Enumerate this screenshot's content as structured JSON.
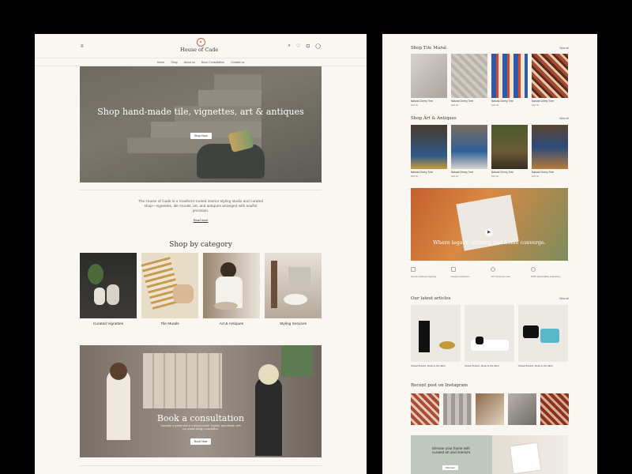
{
  "left": {
    "menu_icon": "menu-icon",
    "brand": "House of Cade",
    "header_icons": [
      "search-icon",
      "heart-icon",
      "bag-icon",
      "user-icon"
    ],
    "nav": [
      "Home",
      "Shop",
      "About us",
      "Book Consultation",
      "Contact us"
    ],
    "hero": {
      "title": "Shop hand-made tile, vignettes, art & antiques",
      "button": "Shop Now"
    },
    "intro": {
      "text": "The House of Cade is a Southern-rooted interior styling studio and curated shop—vignettes, tile murals, art, and antiques arranged with soulful precision.",
      "link": "Read more"
    },
    "category_title": "Shop by category",
    "categories": [
      "Curated Vignettes",
      "Tile Murals",
      "Art & Antiques",
      "Styling Services"
    ],
    "consult": {
      "title": "Book a consultation",
      "text": "Schedule a private visit or a virtual consult. Explore, and elevate, with our private design consultation.",
      "button": "Book Now"
    }
  },
  "right": {
    "tile_title": "Shop Tile Mural",
    "view_all": "View all",
    "tiles": [
      {
        "name": "Natural Cherry Tree",
        "price": "$48.00"
      },
      {
        "name": "Natural Cherry Tree",
        "price": "$48.00"
      },
      {
        "name": "Natural Cherry Tree",
        "price": "$48.00"
      },
      {
        "name": "Natural Cherry Tree",
        "price": "$48.00"
      }
    ],
    "art_title": "Shop Art & Antiques",
    "arts": [
      {
        "name": "Natural Cherry Tree",
        "price": "$48.00"
      },
      {
        "name": "Natural Cherry Tree",
        "price": "$48.00"
      },
      {
        "name": "Natural Cherry Tree",
        "price": "$48.00"
      },
      {
        "name": "Natural Cherry Tree",
        "price": "$48.00"
      }
    ],
    "video_caption": "Where legacy, artistry, and home converge.",
    "features": [
      "Secure checkout shipping",
      "Curated collections",
      "24/7 Customer care",
      "100% Handcrafted Guarantee"
    ],
    "articles_title": "Our latest articles",
    "articles": [
      "Vessel flowers: ideas to the label",
      "Vessel flowers: ideas to the label",
      "Vessel flowers: ideas to the label"
    ],
    "instagram_title": "Recent post on Instagram",
    "promo": {
      "text": "Elevate your home with curated art and interiors",
      "button": "Discover"
    },
    "colors": {
      "background": "#faf7f3",
      "accent": "#c9654a",
      "text": "#3b3632"
    }
  }
}
